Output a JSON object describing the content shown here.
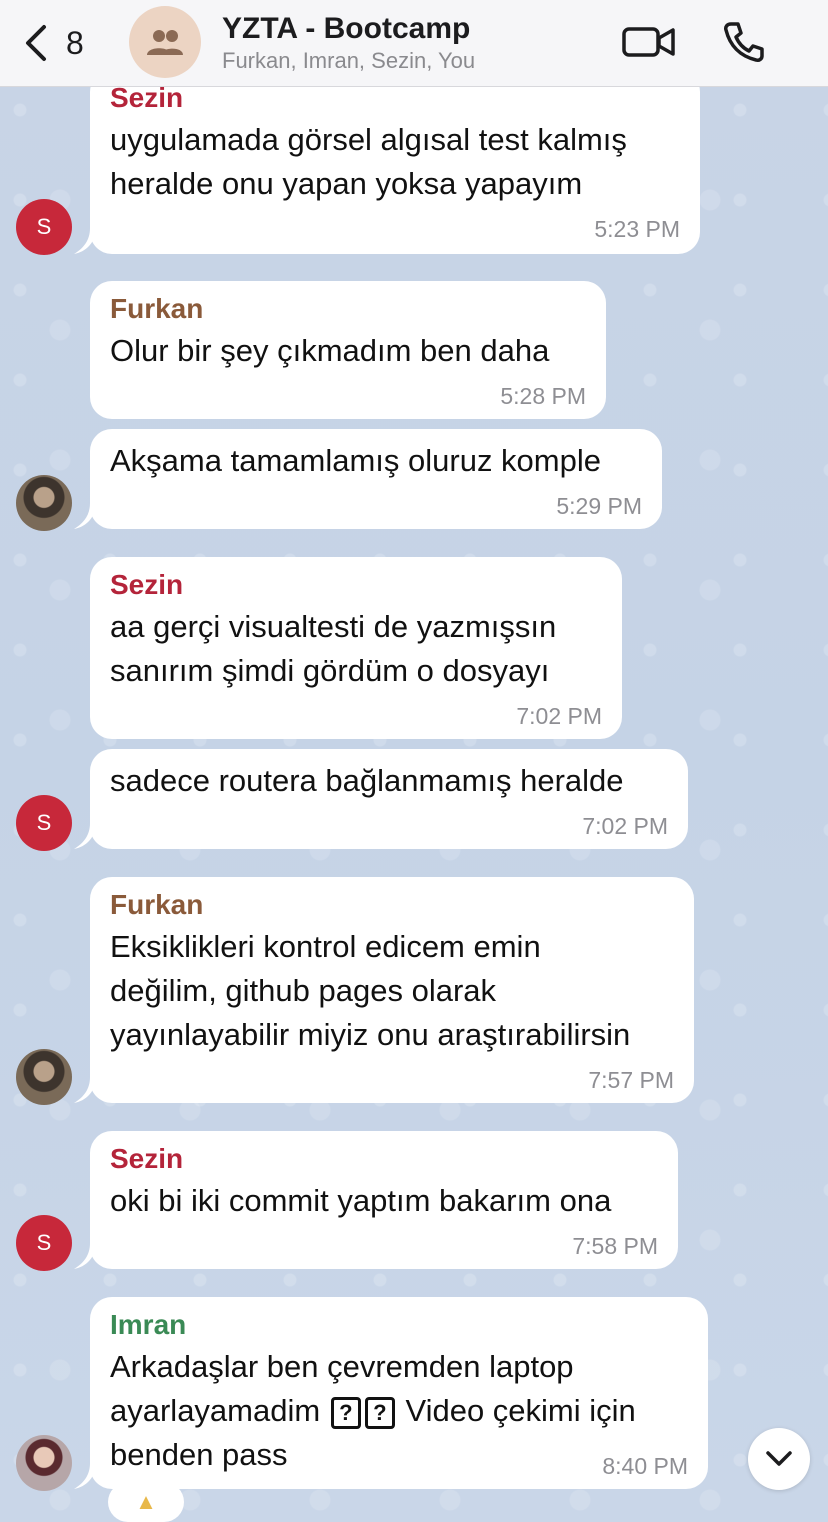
{
  "header": {
    "back_count": "8",
    "title": "YZTA - Bootcamp",
    "members": "Furkan, Imran, Sezin, You"
  },
  "colors": {
    "sezin": "#b4243a",
    "furkan": "#8a5a3a",
    "imran": "#3a8a55"
  },
  "messages": [
    {
      "sender": "Sezin",
      "lines": [
        "uygulamada görsel algısal test kalmış",
        "heralde onu yapan yoksa yapayım"
      ],
      "time": "5:23 PM"
    },
    {
      "sender": "Furkan",
      "lines": [
        "Olur bir şey çıkmadım ben daha"
      ],
      "time": "5:28 PM"
    },
    {
      "lines": [
        "Akşama tamamlamış oluruz komple"
      ],
      "time": "5:29 PM"
    },
    {
      "sender": "Sezin",
      "lines": [
        "aa gerçi visualtesti de yazmışsın",
        "sanırım şimdi gördüm o dosyayı"
      ],
      "time": "7:02 PM"
    },
    {
      "lines": [
        "sadece routera bağlanmamış heralde"
      ],
      "time": "7:02 PM"
    },
    {
      "sender": "Furkan",
      "lines": [
        "Eksiklikleri kontrol edicem emin",
        "değilim, github pages olarak",
        "yayınlayabilir miyiz onu araştırabilirsin"
      ],
      "time": "7:57 PM"
    },
    {
      "sender": "Sezin",
      "lines": [
        "oki bi iki commit yaptım bakarım ona"
      ],
      "time": "7:58 PM"
    },
    {
      "sender": "Imran",
      "lines": [
        "Arkadaşlar ben çevremden laptop",
        "ayarlayamadim",
        "Video çekimi için",
        "benden pass"
      ],
      "time": "8:40 PM"
    }
  ],
  "avatars": {
    "sezin_initial": "S"
  },
  "icons": {
    "back": "chevron-left-icon",
    "group": "group-icon",
    "video": "video-camera-icon",
    "call": "phone-icon",
    "scroll": "chevron-down-icon"
  }
}
